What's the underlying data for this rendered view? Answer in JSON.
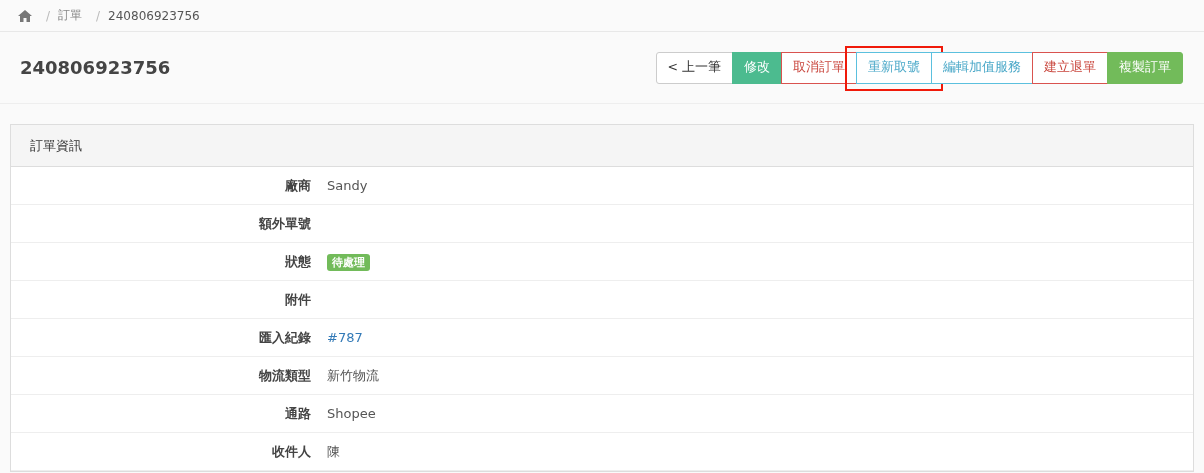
{
  "breadcrumb": [
    {
      "separator": "/",
      "label": "訂單"
    },
    {
      "separator": "/",
      "label": "240806923756"
    }
  ],
  "title": "240806923756",
  "buttons": [
    {
      "label": "< 上一筆",
      "kind": "default",
      "highlighted": false
    },
    {
      "label": "修改",
      "kind": "teal",
      "highlighted": false
    },
    {
      "label": "取消訂單",
      "kind": "danger",
      "highlighted": false
    },
    {
      "label": "重新取號",
      "kind": "info",
      "highlighted": true
    },
    {
      "label": "編輯加值服務",
      "kind": "info",
      "highlighted": false
    },
    {
      "label": "建立退單",
      "kind": "danger",
      "highlighted": false
    },
    {
      "label": "複製訂單",
      "kind": "success",
      "highlighted": false
    }
  ],
  "panel": {
    "title": "訂單資訊",
    "rows": [
      {
        "label": "廠商",
        "kind": "text",
        "value": "Sandy"
      },
      {
        "label": "額外單號",
        "kind": "empty"
      },
      {
        "label": "狀態",
        "kind": "badge",
        "value": "待處理"
      },
      {
        "label": "附件",
        "kind": "empty"
      },
      {
        "label": "匯入紀錄",
        "kind": "link",
        "value": "#787"
      },
      {
        "label": "物流類型",
        "kind": "text",
        "value": "新竹物流"
      },
      {
        "label": "通路",
        "kind": "text",
        "value": "Shopee"
      },
      {
        "label": "收件人",
        "kind": "text",
        "value": "陳"
      }
    ]
  }
}
